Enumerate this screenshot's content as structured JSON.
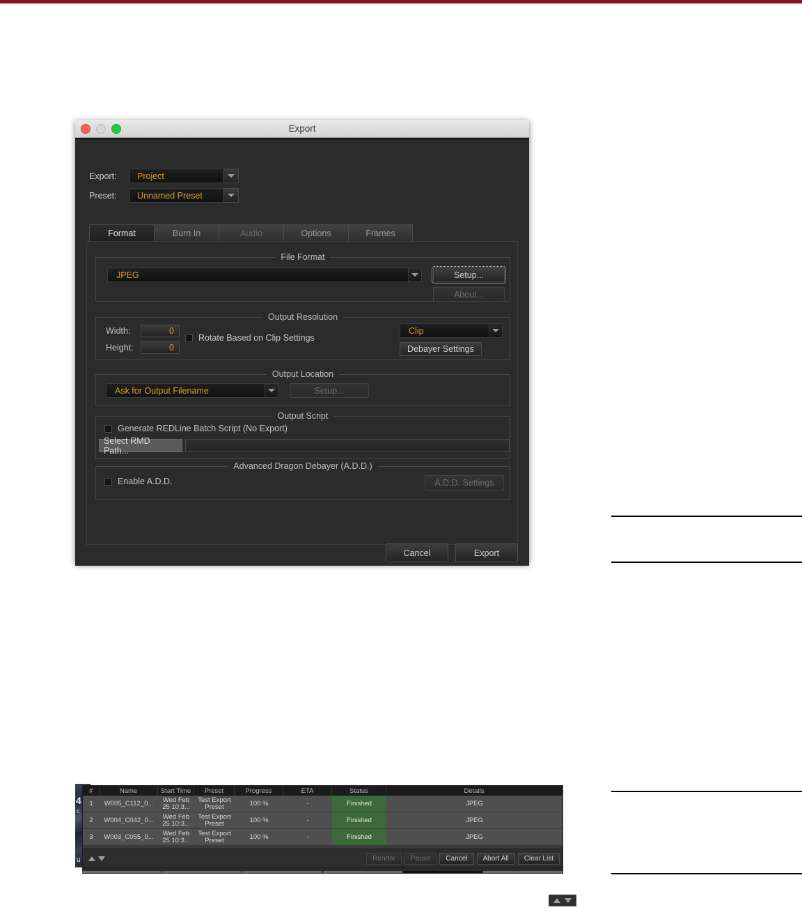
{
  "window": {
    "title": "Export",
    "traffic_lights": [
      "close",
      "minimize",
      "zoom"
    ]
  },
  "top_fields": [
    {
      "label": "Export:",
      "value": "Project"
    },
    {
      "label": "Preset:",
      "value": "Unnamed Preset"
    }
  ],
  "tabs": [
    {
      "label": "Format",
      "state": "active"
    },
    {
      "label": "Burn In",
      "state": "normal"
    },
    {
      "label": "Audio",
      "state": "disabled"
    },
    {
      "label": "Options",
      "state": "normal"
    },
    {
      "label": "Frames",
      "state": "normal"
    }
  ],
  "file_format": {
    "legend": "File Format",
    "value": "JPEG",
    "setup_label": "Setup...",
    "about_label": "About..."
  },
  "output_resolution": {
    "legend": "Output Resolution",
    "width_label": "Width:",
    "width_value": "0",
    "height_label": "Height:",
    "height_value": "0",
    "rotate_label": "Rotate Based on Clip Settings",
    "rotate_checked": false,
    "source_value": "Clip",
    "debayer_label": "Debayer Settings"
  },
  "output_location": {
    "legend": "Output Location",
    "value": "Ask for Output Filename",
    "setup_label": "Setup..."
  },
  "output_script": {
    "legend": "Output Script",
    "generate_label": "Generate REDLine Batch Script (No Export)",
    "generate_checked": false,
    "rmd_button": "Select RMD Path...",
    "rmd_value": ""
  },
  "advanced_debayer": {
    "legend": "Advanced Dragon Debayer (A.D.D.)",
    "enable_label": "Enable A.D.D.",
    "enable_checked": false,
    "settings_label": "A.D.D. Settings"
  },
  "dialog_actions": {
    "cancel_label": "Cancel",
    "export_label": "Export"
  },
  "queue": {
    "columns": [
      "#",
      "Name",
      "Start Time",
      "Preset",
      "Progress",
      "ETA",
      "Status",
      "Details"
    ],
    "rows": [
      {
        "num": "1",
        "name": "W005_C112_0...",
        "start_time": "Wed Feb 25 10:3...",
        "preset": "Test Export Preset",
        "progress": "100 %",
        "eta": "-",
        "status": "Finished",
        "details": "JPEG"
      },
      {
        "num": "2",
        "name": "W004_C042_0...",
        "start_time": "Wed Feb 25 10:3...",
        "preset": "Test Export Preset",
        "progress": "100 %",
        "eta": "-",
        "status": "Finished",
        "details": "JPEG"
      },
      {
        "num": "3",
        "name": "W003_C055_0...",
        "start_time": "Wed Feb 25 10:3...",
        "preset": "Test Export Preset",
        "progress": "100 %",
        "eta": "-",
        "status": "Finished",
        "details": "JPEG"
      }
    ],
    "buttons": [
      {
        "label": "Render",
        "state": "disabled"
      },
      {
        "label": "Pause",
        "state": "disabled"
      },
      {
        "label": "Cancel",
        "state": "normal"
      },
      {
        "label": "Abort All",
        "state": "normal"
      },
      {
        "label": "Clear List",
        "state": "normal"
      }
    ]
  },
  "edge_overlay": {
    "number": "4",
    "letter_c": "c",
    "letter_u": "u"
  },
  "colors": {
    "accent_orange": "#d89b2c",
    "status_green": "#3d6a3a",
    "top_rule_red": "#8b1522",
    "dialog_bg": "#2b2b2b"
  }
}
